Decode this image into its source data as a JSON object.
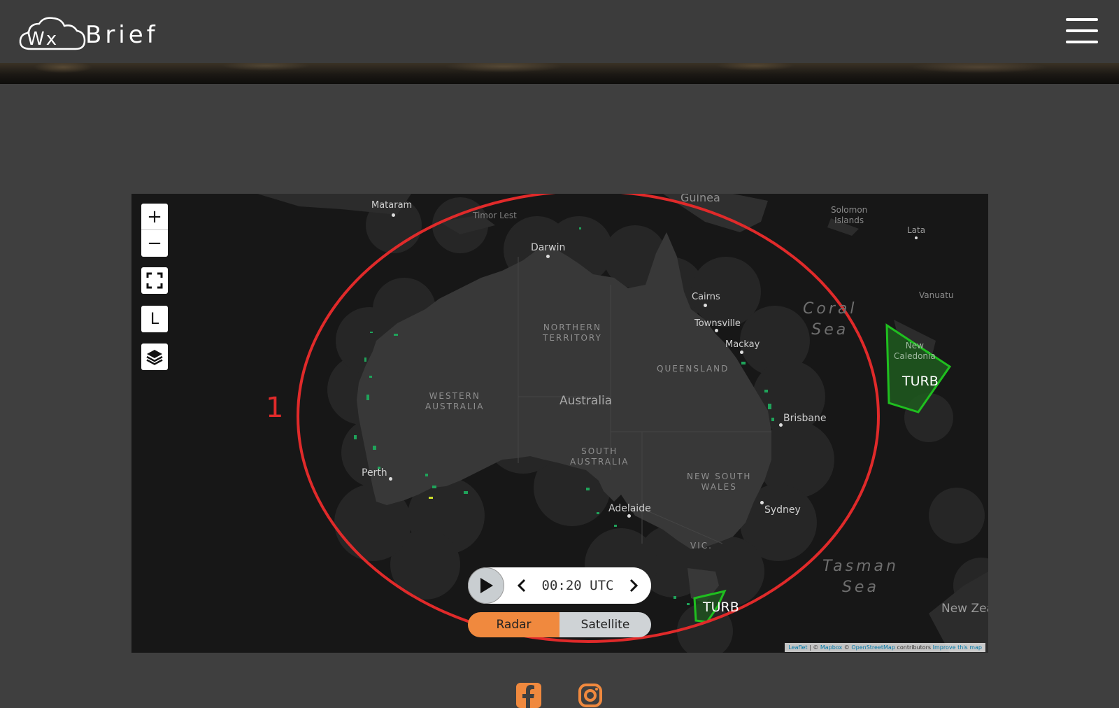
{
  "header": {
    "logo_text": "Brief",
    "logo_mark": "Wx",
    "menu_icon": "hamburger-icon"
  },
  "map": {
    "controls": {
      "zoom_in": "+",
      "zoom_out": "−",
      "fullscreen_icon": "fullscreen-icon",
      "legend_button": "L",
      "layers_icon": "layers-icon"
    },
    "places": [
      {
        "name": "Mataram"
      },
      {
        "name": "Timor Lest"
      },
      {
        "name": "Guinea"
      },
      {
        "name": "Solomon\nIslands"
      },
      {
        "name": "Lata"
      },
      {
        "name": "Darwin"
      },
      {
        "name": "Vanuatu"
      },
      {
        "name": "Cairns"
      },
      {
        "name": "Townsville"
      },
      {
        "name": "Mackay"
      },
      {
        "name": "Brisbane"
      },
      {
        "name": "Perth"
      },
      {
        "name": "Adelaide"
      },
      {
        "name": "Sydney"
      },
      {
        "name": "Australia"
      },
      {
        "name": "New\nCaledonia"
      },
      {
        "name": "New Zea"
      }
    ],
    "regions": {
      "northern_territory": "NORTHERN\nTERRITORY",
      "western_australia": "WESTERN\nAUSTRALIA",
      "queensland": "QUEENSLAND",
      "south_australia": "SOUTH\nAUSTRALIA",
      "new_south_wales": "NEW SOUTH\nWALES",
      "victoria": "VIC."
    },
    "seas": {
      "coral": "Coral\nSea",
      "tasman": "Tasman\nSea"
    },
    "overlays": {
      "turb_east": "TURB",
      "turb_south": "TURB",
      "annotation_number": "1"
    },
    "timebar": {
      "time": "00:20 UTC",
      "play_icon": "play-icon",
      "prev_icon": "chevron-left-icon",
      "next_icon": "chevron-right-icon"
    },
    "layer_toggle": {
      "radar": "Radar",
      "satellite": "Satellite",
      "active": "Radar"
    },
    "attribution": {
      "leaflet": "Leaflet",
      "sep1": " | © ",
      "mapbox": "Mapbox",
      "sep2": " © ",
      "osm": "OpenStreetMap",
      "contributors": " contributors ",
      "improve": "Improve this map"
    },
    "colors": {
      "turb_fill": "#1e5a1e",
      "turb_stroke": "#1fbf1f",
      "annotation": "#e02a2a",
      "radar_active": "#f0893e"
    }
  },
  "footer": {
    "facebook_icon": "facebook-icon",
    "instagram_icon": "instagram-icon"
  }
}
